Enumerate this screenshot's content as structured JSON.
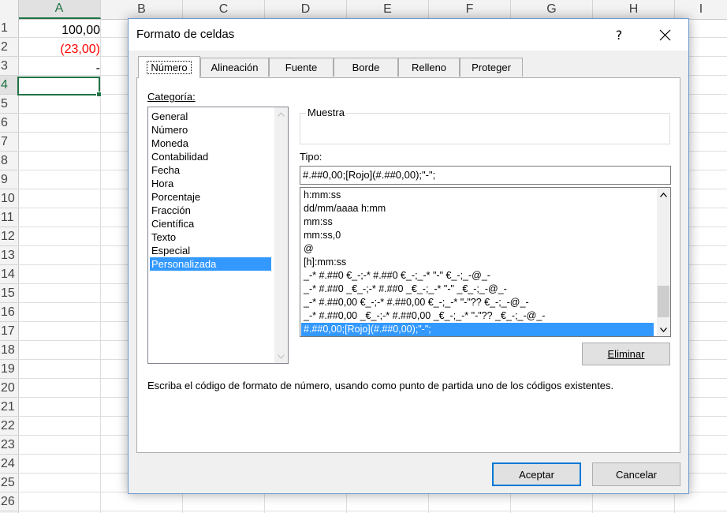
{
  "sheet": {
    "columns": [
      "A",
      "B",
      "C",
      "D",
      "E",
      "F",
      "G",
      "H",
      "I"
    ],
    "rows": [
      "1",
      "2",
      "3",
      "4",
      "5",
      "6",
      "7",
      "8",
      "9",
      "10",
      "11",
      "12",
      "13",
      "14",
      "15",
      "16",
      "17",
      "18",
      "19",
      "20",
      "21",
      "22",
      "23",
      "24",
      "25",
      "26"
    ],
    "cells": [
      {
        "ref": "A1",
        "value": "100,00",
        "color": "#000000"
      },
      {
        "ref": "A2",
        "value": "(23,00)",
        "color": "#ff0000"
      },
      {
        "ref": "A3",
        "value": "-",
        "color": "#000000"
      }
    ],
    "active_cell": "A4",
    "accent_color": "#217346"
  },
  "dialog": {
    "title": "Formato de celdas",
    "help_label": "?",
    "tabs": [
      {
        "label": "Número",
        "active": true
      },
      {
        "label": "Alineación",
        "active": false
      },
      {
        "label": "Fuente",
        "active": false
      },
      {
        "label": "Borde",
        "active": false
      },
      {
        "label": "Relleno",
        "active": false
      },
      {
        "label": "Proteger",
        "active": false
      }
    ],
    "category_label": "Categoría:",
    "categories": [
      "General",
      "Número",
      "Moneda",
      "Contabilidad",
      "Fecha",
      "Hora",
      "Porcentaje",
      "Fracción",
      "Científica",
      "Texto",
      "Especial",
      "Personalizada"
    ],
    "selected_category": "Personalizada",
    "sample_label": "Muestra",
    "type_label": "Tipo:",
    "type_value": "#.##0,00;[Rojo](#.##0,00);\"-\";",
    "format_list": [
      "h:mm:ss",
      "dd/mm/aaaa h:mm",
      "mm:ss",
      "mm:ss,0",
      "@",
      "[h]:mm:ss",
      "_-* #.##0 €_-;-* #.##0 €_-;_-* \"-\" €_-;_-@_-",
      "_-* #.##0 _€_-;-* #.##0 _€_-;_-* \"-\" _€_-;_-@_-",
      "_-* #.##0,00 €_-;-* #.##0,00 €_-;_-* \"-\"?? €_-;_-@_-",
      "_-* #.##0,00 _€_-;-* #.##0,00 _€_-;_-* \"-\"?? _€_-;_-@_-",
      "#.##0,00;[Rojo](#.##0,00);\"-\";"
    ],
    "selected_format_index": 10,
    "delete_button": "Eliminar",
    "description": "Escriba el código de formato de número, usando como punto de partida uno de los códigos existentes.",
    "ok_button": "Aceptar",
    "cancel_button": "Cancelar",
    "selection_color": "#3399ff",
    "default_button_border": "#0078d7"
  }
}
